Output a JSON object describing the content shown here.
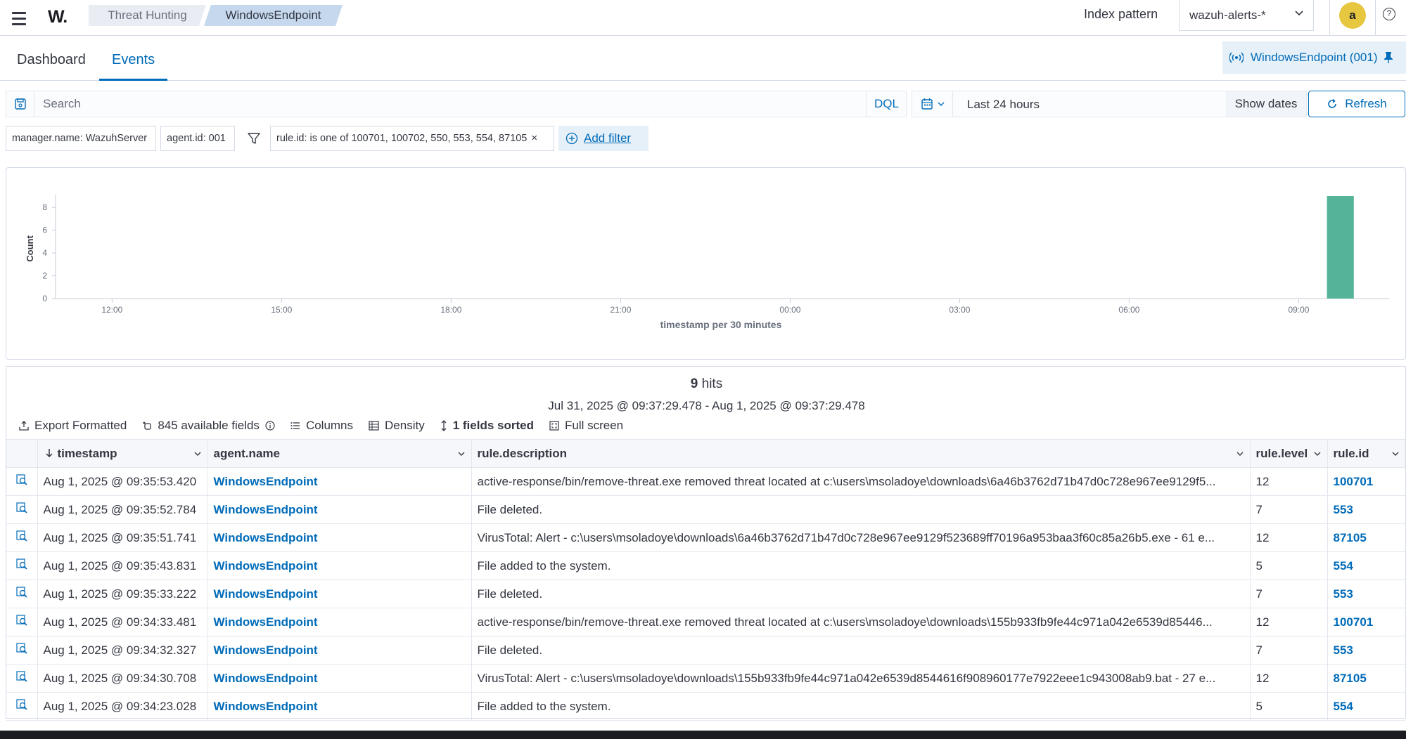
{
  "header": {
    "logo": "W.",
    "breadcrumbs": [
      "Threat Hunting",
      "WindowsEndpoint"
    ],
    "index_pattern_label": "Index pattern",
    "index_pattern_value": "wazuh-alerts-*",
    "avatar_initial": "a",
    "help": "?"
  },
  "tabs": {
    "dashboard": "Dashboard",
    "events": "Events",
    "active": "Events",
    "pinned_agent": "WindowsEndpoint (001)"
  },
  "search": {
    "placeholder": "Search",
    "language": "DQL",
    "time_range": "Last 24 hours",
    "show_dates": "Show dates",
    "refresh": "Refresh"
  },
  "filters": {
    "pills": [
      "manager.name: WazuhServer",
      "agent.id: 001"
    ],
    "rule_filter": "rule.id: is one of 100701, 100702, 550, 553, 554, 87105",
    "add_filter": "Add filter"
  },
  "chart_data": {
    "type": "bar",
    "xlabel": "timestamp per 30 minutes",
    "ylabel": "Count",
    "ylim": [
      0,
      9
    ],
    "yticks": [
      0,
      2,
      4,
      6,
      8
    ],
    "xticks": [
      "12:00",
      "15:00",
      "18:00",
      "21:00",
      "00:00",
      "03:00",
      "06:00",
      "09:00"
    ],
    "bars": [
      {
        "x": "09:30",
        "value": 9
      }
    ],
    "bar_color": "#54b399",
    "grid": false
  },
  "results": {
    "hits_count": "9",
    "hits_label": "hits",
    "range": "Jul 31, 2025 @ 09:37:29.478 - Aug 1, 2025 @ 09:37:29.478",
    "toolbar": {
      "export": "Export Formatted",
      "fields": "845 available fields",
      "columns": "Columns",
      "density": "Density",
      "sorted": "1 fields sorted",
      "fullscreen": "Full screen"
    },
    "columns": [
      "timestamp",
      "agent.name",
      "rule.description",
      "rule.level",
      "rule.id"
    ],
    "rows": [
      {
        "timestamp": "Aug 1, 2025 @ 09:35:53.420",
        "agent": "WindowsEndpoint",
        "description": "active-response/bin/remove-threat.exe removed threat located at c:\\users\\msoladoye\\downloads\\6a46b3762d71b47d0c728e967ee9129f5...",
        "level": "12",
        "rule_id": "100701"
      },
      {
        "timestamp": "Aug 1, 2025 @ 09:35:52.784",
        "agent": "WindowsEndpoint",
        "description": "File deleted.",
        "level": "7",
        "rule_id": "553"
      },
      {
        "timestamp": "Aug 1, 2025 @ 09:35:51.741",
        "agent": "WindowsEndpoint",
        "description": "VirusTotal: Alert - c:\\users\\msoladoye\\downloads\\6a46b3762d71b47d0c728e967ee9129f523689ff70196a953baa3f60c85a26b5.exe - 61 e...",
        "level": "12",
        "rule_id": "87105"
      },
      {
        "timestamp": "Aug 1, 2025 @ 09:35:43.831",
        "agent": "WindowsEndpoint",
        "description": "File added to the system.",
        "level": "5",
        "rule_id": "554"
      },
      {
        "timestamp": "Aug 1, 2025 @ 09:35:33.222",
        "agent": "WindowsEndpoint",
        "description": "File deleted.",
        "level": "7",
        "rule_id": "553"
      },
      {
        "timestamp": "Aug 1, 2025 @ 09:34:33.481",
        "agent": "WindowsEndpoint",
        "description": "active-response/bin/remove-threat.exe removed threat located at c:\\users\\msoladoye\\downloads\\155b933fb9fe44c971a042e6539d85446...",
        "level": "12",
        "rule_id": "100701"
      },
      {
        "timestamp": "Aug 1, 2025 @ 09:34:32.327",
        "agent": "WindowsEndpoint",
        "description": "File deleted.",
        "level": "7",
        "rule_id": "553"
      },
      {
        "timestamp": "Aug 1, 2025 @ 09:34:30.708",
        "agent": "WindowsEndpoint",
        "description": "VirusTotal: Alert - c:\\users\\msoladoye\\downloads\\155b933fb9fe44c971a042e6539d8544616f908960177e7922eee1c943008ab9.bat - 27 e...",
        "level": "12",
        "rule_id": "87105"
      },
      {
        "timestamp": "Aug 1, 2025 @ 09:34:23.028",
        "agent": "WindowsEndpoint",
        "description": "File added to the system.",
        "level": "5",
        "rule_id": "554"
      }
    ]
  }
}
